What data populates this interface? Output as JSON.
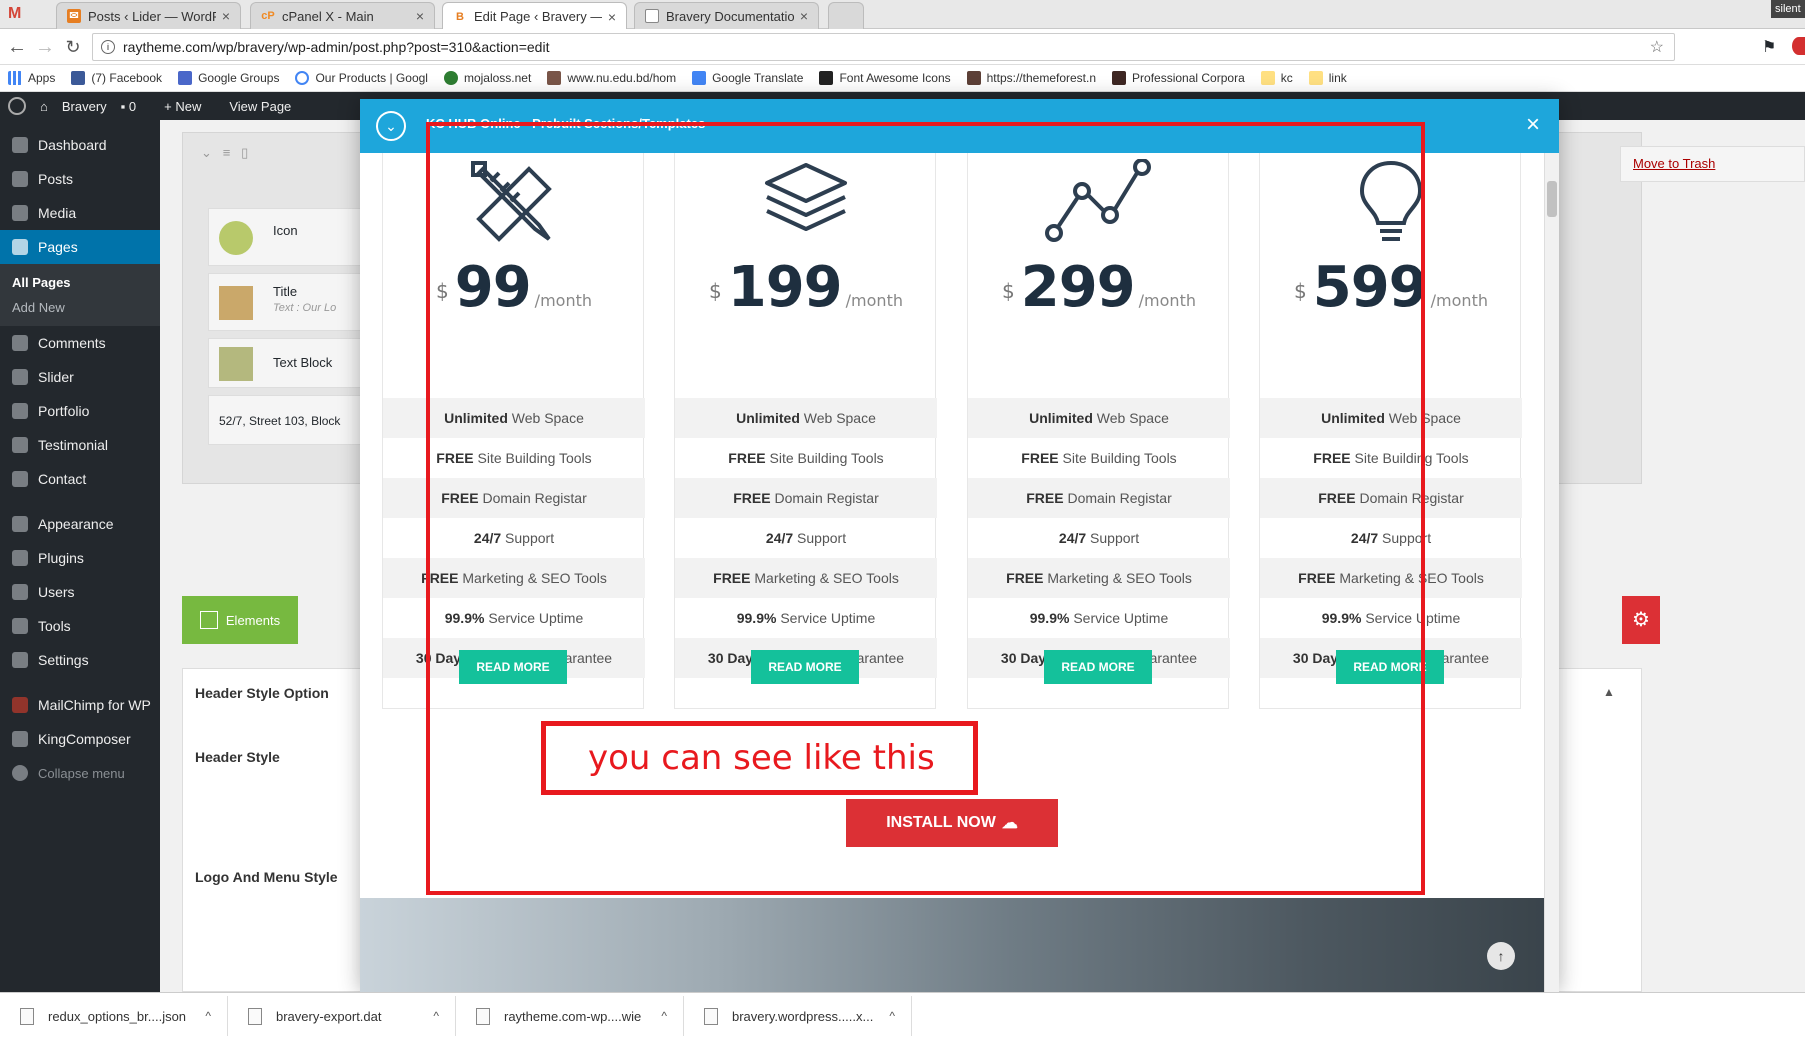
{
  "browser": {
    "tabs": [
      {
        "label": "Posts ‹ Lider — WordPre",
        "favicon": "wp-admin-icon"
      },
      {
        "label": "cPanel X - Main",
        "favicon": "cpanel-icon"
      },
      {
        "label": "Edit Page ‹ Bravery — W",
        "favicon": "bravery-icon"
      },
      {
        "label": "Bravery Documentation",
        "favicon": "page-icon"
      }
    ],
    "corner_label": "silent",
    "url": "raytheme.com/wp/bravery/wp-admin/post.php?post=310&action=edit",
    "bookmarks": [
      "Apps",
      "(7) Facebook",
      "Google Groups",
      "Our Products | Googl",
      "mojaloss.net",
      "www.nu.edu.bd/hom",
      "Google Translate",
      "Font Awesome Icons",
      "https://themeforest.n",
      "Professional Corpora",
      "kc",
      "link"
    ]
  },
  "adminbar": {
    "site": "Bravery",
    "comments": "0",
    "new": "New",
    "view": "View Page"
  },
  "sidebar": {
    "items": [
      "Dashboard",
      "Posts",
      "Media",
      "Pages",
      "Comments",
      "Slider",
      "Portfolio",
      "Testimonial",
      "Contact",
      "Appearance",
      "Plugins",
      "Users",
      "Tools",
      "Settings",
      "MailChimp for WP",
      "KingComposer",
      "Collapse menu"
    ],
    "submenu": [
      "All Pages",
      "Add New"
    ]
  },
  "editor": {
    "elements": [
      {
        "label": "Icon",
        "sub": ""
      },
      {
        "label": "Title",
        "sub": "Text : Our Lo"
      },
      {
        "label": "Text Block",
        "sub": ""
      }
    ],
    "address_text": "52/7, Street 103, Block",
    "elements_button": "Elements",
    "trash_link": "Move to Trash",
    "option_labels": [
      "Header Style Option",
      "Header Style",
      "Logo And Menu Style"
    ]
  },
  "modal": {
    "title": "KC HUB Online - Prebuilt Sections/Templates",
    "install_label": "INSTALL NOW",
    "plans": [
      {
        "icon": "pencil-ruler-icon",
        "currency": "$",
        "amount": "99",
        "period": "/month"
      },
      {
        "icon": "layers-icon",
        "currency": "$",
        "amount": "199",
        "period": "/month"
      },
      {
        "icon": "line-chart-icon",
        "currency": "$",
        "amount": "299",
        "period": "/month"
      },
      {
        "icon": "lightbulb-icon",
        "currency": "$",
        "amount": "599",
        "period": "/month"
      }
    ],
    "features": [
      {
        "bold": "Unlimited",
        "rest": " Web Space"
      },
      {
        "bold": "FREE",
        "rest": " Site Building Tools"
      },
      {
        "bold": "FREE",
        "rest": " Domain Registar"
      },
      {
        "bold": "24/7",
        "rest": " Support"
      },
      {
        "bold": "FREE",
        "rest": " Marketing & SEO Tools"
      },
      {
        "bold": "99.9%",
        "rest": " Service Uptime"
      },
      {
        "bold": "30 Day",
        "rest": " Money Back Guarantee"
      }
    ],
    "read_more": "READ MORE"
  },
  "annotation": {
    "note": "you can see like this",
    "color": "#e8191e"
  },
  "downloads": [
    "redux_options_br....json",
    "bravery-export.dat",
    "raytheme.com-wp....wie",
    "bravery.wordpress.....x..."
  ],
  "colors": {
    "accent": "#1ea6db",
    "button": "#14c19b",
    "install": "#dc3035",
    "admin": "#23282d"
  }
}
